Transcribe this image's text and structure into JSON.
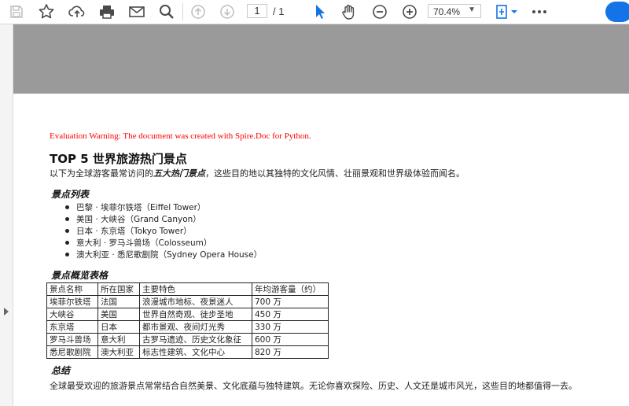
{
  "toolbar": {
    "page_current": "1",
    "page_sep": "/ 1",
    "zoom": "70.4%",
    "icons": [
      "save-icon",
      "bookmark-star-icon",
      "upload-cloud-icon",
      "print-icon",
      "email-icon",
      "search-zoom-icon",
      "page-up-icon",
      "page-down-icon",
      "select-pointer-icon",
      "hand-pan-icon",
      "zoom-out-icon",
      "zoom-in-icon",
      "fit-page-icon",
      "more-icon"
    ],
    "accent_color": "#1473e6"
  },
  "document": {
    "eval_warning": "Evaluation Warning: The document was created with Spire.Doc for Python.",
    "title": "TOP 5 世界旅游热门景点",
    "intro_pre": "以下为全球游客最常访问的",
    "intro_em": "五大热门景点",
    "intro_post": "，这些目的地以其独特的文化风情、壮丽景观和世界级体验而闻名。",
    "list_heading": "景点列表",
    "list_items": [
      "巴黎 · 埃菲尔铁塔（Eiffel Tower）",
      "美国 · 大峡谷（Grand Canyon）",
      "日本 · 东京塔（Tokyo Tower）",
      "意大利 · 罗马斗兽场（Colosseum）",
      "澳大利亚 · 悉尼歌剧院（Sydney Opera House）"
    ],
    "table_heading": "景点概览表格",
    "table": {
      "headers": [
        "景点名称",
        "所在国家",
        "主要特色",
        "年均游客量（约）"
      ],
      "rows": [
        [
          "埃菲尔铁塔",
          "法国",
          "浪漫城市地标、夜景迷人",
          "700 万"
        ],
        [
          "大峡谷",
          "美国",
          "世界自然奇观、徒步圣地",
          "450 万"
        ],
        [
          "东京塔",
          "日本",
          "都市景观、夜间灯光秀",
          "330 万"
        ],
        [
          "罗马斗兽场",
          "意大利",
          "古罗马遗迹、历史文化象征",
          "600 万"
        ],
        [
          "悉尼歌剧院",
          "澳大利亚",
          "标志性建筑、文化中心",
          "820 万"
        ]
      ]
    },
    "summary_heading": "总结",
    "summary": "全球最受欢迎的旅游景点常常结合自然美景、文化底蕴与独特建筑。无论你喜欢探险、历史、人文还是城市风光，这些目的地都值得一去。"
  }
}
